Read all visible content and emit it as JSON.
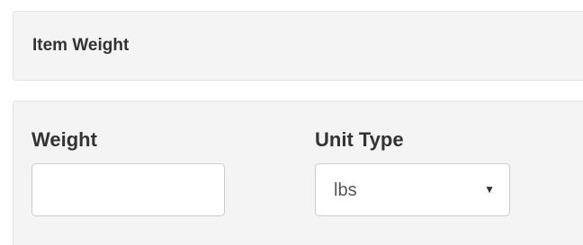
{
  "header": {
    "title": "Item Weight"
  },
  "form": {
    "weight_label": "Weight",
    "weight_value": "",
    "unit_label": "Unit Type",
    "unit_selected": "lbs"
  },
  "icons": {
    "dropdown": "chevron-down-icon"
  },
  "colors": {
    "panel_bg": "#f4f4f4",
    "panel_border": "#e3e3e3",
    "label_text": "#333333",
    "input_text": "#555555"
  }
}
